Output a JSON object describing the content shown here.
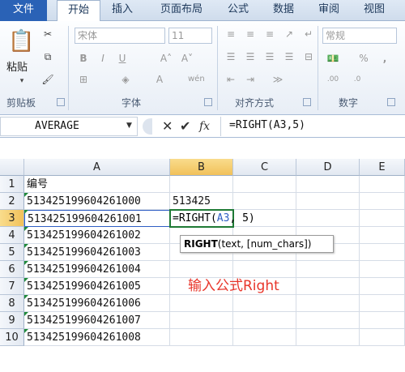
{
  "tabs": [
    "文件",
    "开始",
    "插入",
    "页面布局",
    "公式",
    "数据",
    "审阅",
    "视图"
  ],
  "ribbon": {
    "paste_label": "粘贴",
    "font_name": "宋体",
    "font_size": "11",
    "number_format": "常规",
    "groups": [
      "剪贴板",
      "字体",
      "对齐方式",
      "数字"
    ]
  },
  "formula_bar": {
    "name_box": "AVERAGE",
    "formula": "=RIGHT(A3,5)"
  },
  "columns": [
    "A",
    "B",
    "C",
    "D",
    "E"
  ],
  "rows": [
    {
      "num": "1",
      "a": "编号",
      "b": ""
    },
    {
      "num": "2",
      "a": "513425199604261000",
      "b": "513425"
    },
    {
      "num": "3",
      "a": "513425199604261001",
      "b": ""
    },
    {
      "num": "4",
      "a": "513425199604261002",
      "b": ""
    },
    {
      "num": "5",
      "a": "513425199604261003",
      "b": ""
    },
    {
      "num": "6",
      "a": "513425199604261004",
      "b": ""
    },
    {
      "num": "7",
      "a": "513425199604261005",
      "b": ""
    },
    {
      "num": "8",
      "a": "513425199604261006",
      "b": ""
    },
    {
      "num": "9",
      "a": "513425199604261007",
      "b": ""
    },
    {
      "num": "10",
      "a": "513425199604261008",
      "b": ""
    }
  ],
  "editing": {
    "prefix": "=RIGHT(",
    "ref": "A3",
    "suffix": ", 5)"
  },
  "tooltip": {
    "func": "RIGHT",
    "args": "(text, [num_chars])"
  },
  "annotation": "输入公式Right",
  "colors": {
    "ref_blue": "#2f5ec4",
    "annotation_red": "#e8352a",
    "select_green": "#1f7a35"
  }
}
